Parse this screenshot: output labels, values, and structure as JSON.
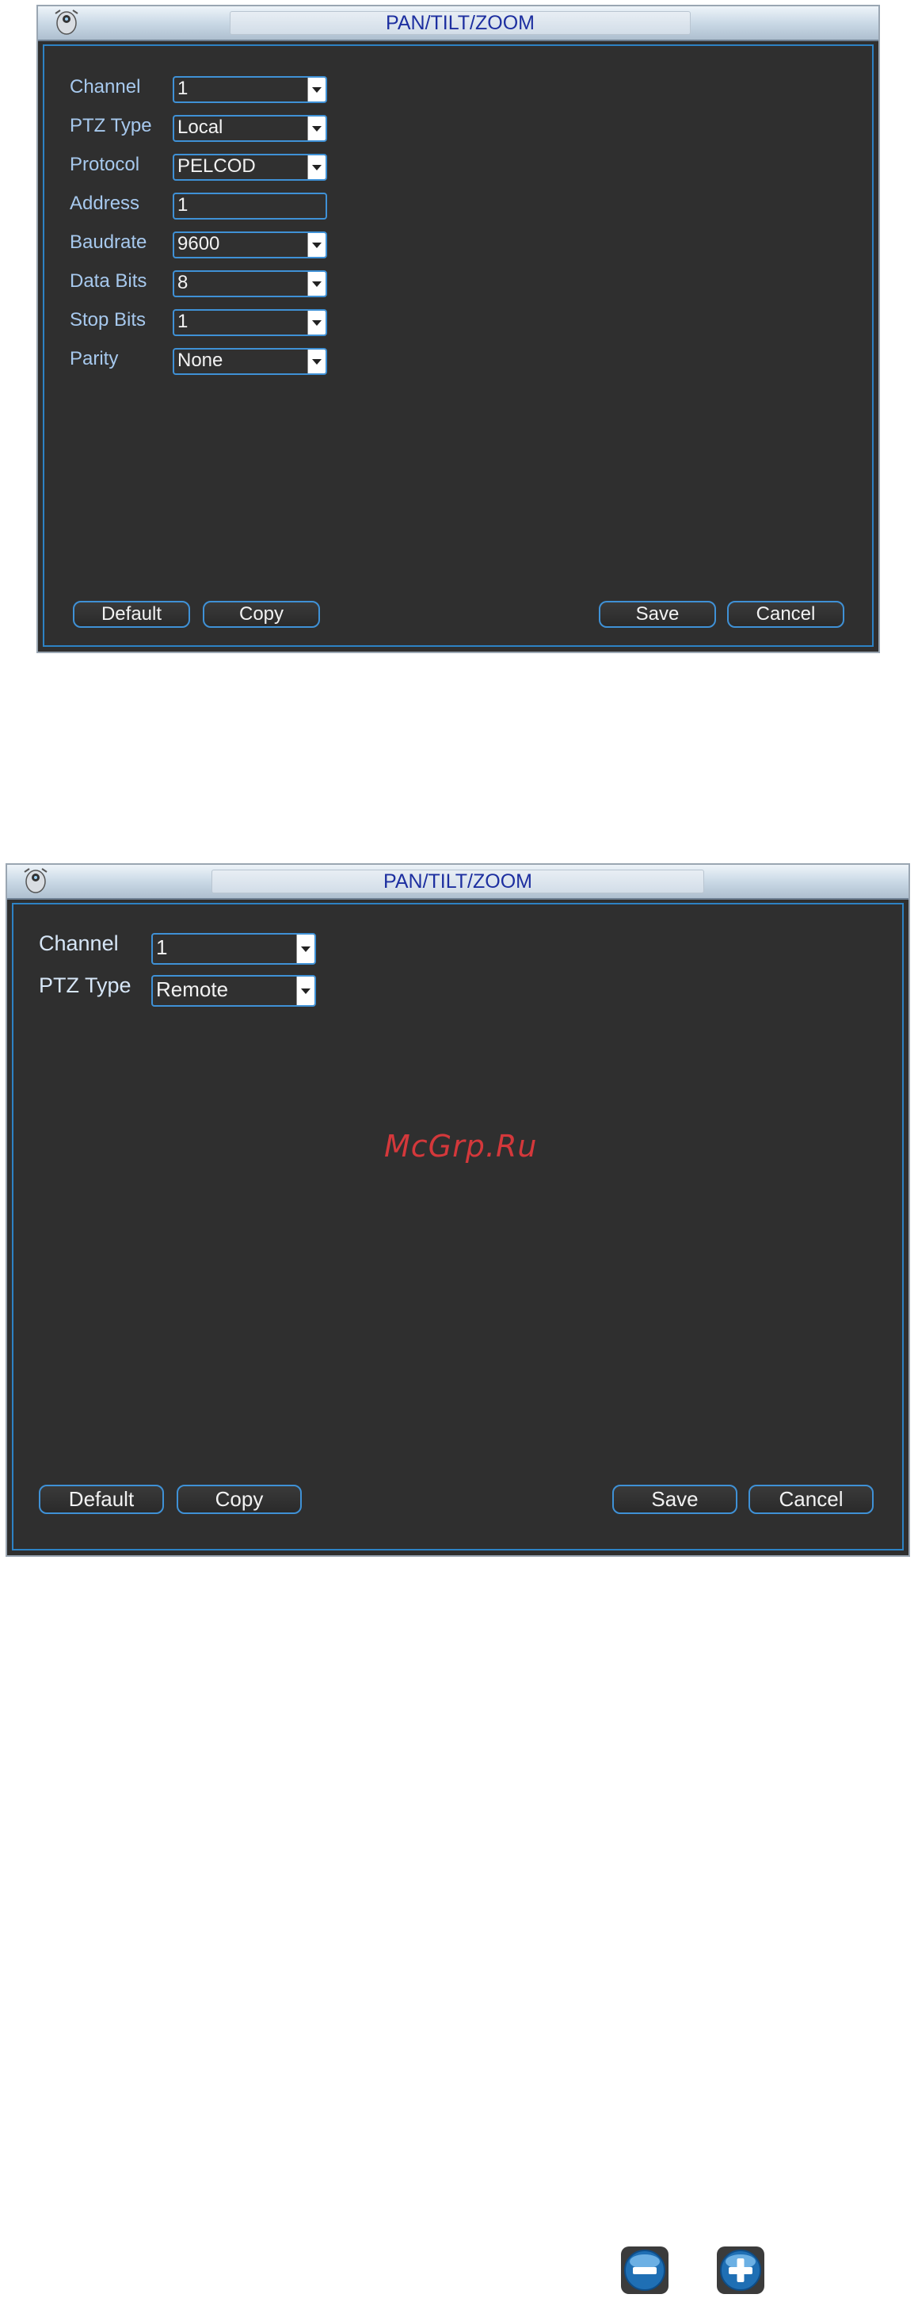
{
  "dialog_local": {
    "title": "PAN/TILT/ZOOM",
    "fields": {
      "channel": {
        "label": "Channel",
        "value": "1"
      },
      "ptz_type": {
        "label": "PTZ Type",
        "value": "Local"
      },
      "protocol": {
        "label": "Protocol",
        "value": "PELCOD"
      },
      "address": {
        "label": "Address",
        "value": "1"
      },
      "baudrate": {
        "label": "Baudrate",
        "value": "9600"
      },
      "data_bits": {
        "label": "Data Bits",
        "value": "8"
      },
      "stop_bits": {
        "label": "Stop Bits",
        "value": "1"
      },
      "parity": {
        "label": "Parity",
        "value": "None"
      }
    },
    "buttons": {
      "default": "Default",
      "copy": "Copy",
      "save": "Save",
      "cancel": "Cancel"
    }
  },
  "dialog_remote": {
    "title": "PAN/TILT/ZOOM",
    "fields": {
      "channel": {
        "label": "Channel",
        "value": "1"
      },
      "ptz_type": {
        "label": "PTZ Type",
        "value": "Remote"
      }
    },
    "buttons": {
      "default": "Default",
      "copy": "Copy",
      "save": "Save",
      "cancel": "Cancel"
    }
  },
  "watermark": "McGrp.Ru",
  "icons": {
    "zoom_out": "zoom-out-icon",
    "zoom_in": "zoom-in-icon"
  },
  "colors": {
    "panel_bg": "#2f2f2f",
    "accent_border": "#3f91d6",
    "title_text": "#1d2fa0",
    "label_text": "#a7c9ee",
    "watermark": "#d4383b"
  }
}
